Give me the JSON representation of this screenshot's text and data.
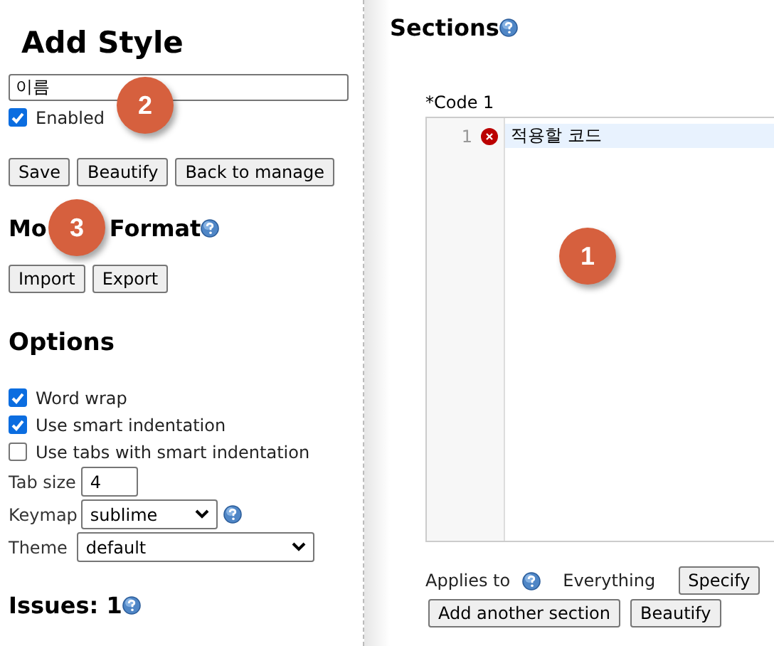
{
  "title": "Add Style",
  "name_field": {
    "value": "이름"
  },
  "enabled": {
    "label": "Enabled",
    "checked": true
  },
  "actions": [
    "Save",
    "Beautify",
    "Back to manage"
  ],
  "mozilla_format": {
    "heading_parts": [
      "Mo",
      "Format"
    ],
    "buttons": [
      "Import",
      "Export"
    ]
  },
  "options": {
    "heading": "Options",
    "checkboxes": [
      {
        "label": "Word wrap",
        "checked": true
      },
      {
        "label": "Use smart indentation",
        "checked": true
      },
      {
        "label": "Use tabs with smart indentation",
        "checked": false
      }
    ],
    "tab_size": {
      "label": "Tab size",
      "value": "4"
    },
    "keymap": {
      "label": "Keymap",
      "value": "sublime"
    },
    "theme": {
      "label": "Theme",
      "value": "default"
    }
  },
  "issues": {
    "heading": "Issues: 1"
  },
  "sections": {
    "heading": "Sections",
    "code_label": "*Code 1",
    "lines": [
      {
        "number": "1",
        "error": true,
        "text": "적용할 코드",
        "active": true
      }
    ],
    "applies_to": {
      "label": "Applies to",
      "value": "Everything",
      "button": "Specify"
    },
    "buttons": [
      "Add another section",
      "Beautify"
    ]
  },
  "annotations": [
    {
      "label": "2"
    },
    {
      "label": "3"
    },
    {
      "label": "1"
    }
  ]
}
